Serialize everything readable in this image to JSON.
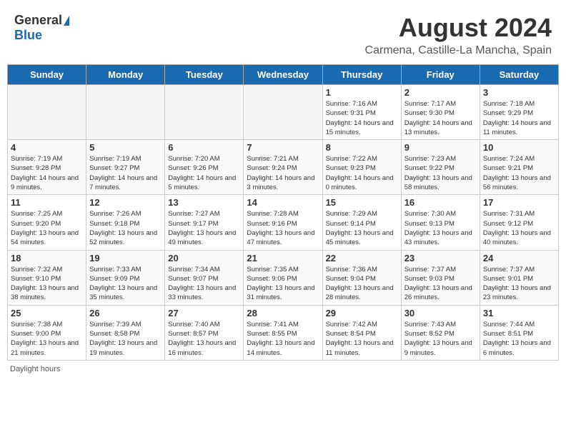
{
  "header": {
    "logo_general": "General",
    "logo_blue": "Blue",
    "month_year": "August 2024",
    "location": "Carmena, Castille-La Mancha, Spain"
  },
  "days_of_week": [
    "Sunday",
    "Monday",
    "Tuesday",
    "Wednesday",
    "Thursday",
    "Friday",
    "Saturday"
  ],
  "weeks": [
    [
      {
        "day": "",
        "info": ""
      },
      {
        "day": "",
        "info": ""
      },
      {
        "day": "",
        "info": ""
      },
      {
        "day": "",
        "info": ""
      },
      {
        "day": "1",
        "info": "Sunrise: 7:16 AM\nSunset: 9:31 PM\nDaylight: 14 hours and 15 minutes."
      },
      {
        "day": "2",
        "info": "Sunrise: 7:17 AM\nSunset: 9:30 PM\nDaylight: 14 hours and 13 minutes."
      },
      {
        "day": "3",
        "info": "Sunrise: 7:18 AM\nSunset: 9:29 PM\nDaylight: 14 hours and 11 minutes."
      }
    ],
    [
      {
        "day": "4",
        "info": "Sunrise: 7:19 AM\nSunset: 9:28 PM\nDaylight: 14 hours and 9 minutes."
      },
      {
        "day": "5",
        "info": "Sunrise: 7:19 AM\nSunset: 9:27 PM\nDaylight: 14 hours and 7 minutes."
      },
      {
        "day": "6",
        "info": "Sunrise: 7:20 AM\nSunset: 9:26 PM\nDaylight: 14 hours and 5 minutes."
      },
      {
        "day": "7",
        "info": "Sunrise: 7:21 AM\nSunset: 9:24 PM\nDaylight: 14 hours and 3 minutes."
      },
      {
        "day": "8",
        "info": "Sunrise: 7:22 AM\nSunset: 9:23 PM\nDaylight: 14 hours and 0 minutes."
      },
      {
        "day": "9",
        "info": "Sunrise: 7:23 AM\nSunset: 9:22 PM\nDaylight: 13 hours and 58 minutes."
      },
      {
        "day": "10",
        "info": "Sunrise: 7:24 AM\nSunset: 9:21 PM\nDaylight: 13 hours and 56 minutes."
      }
    ],
    [
      {
        "day": "11",
        "info": "Sunrise: 7:25 AM\nSunset: 9:20 PM\nDaylight: 13 hours and 54 minutes."
      },
      {
        "day": "12",
        "info": "Sunrise: 7:26 AM\nSunset: 9:18 PM\nDaylight: 13 hours and 52 minutes."
      },
      {
        "day": "13",
        "info": "Sunrise: 7:27 AM\nSunset: 9:17 PM\nDaylight: 13 hours and 49 minutes."
      },
      {
        "day": "14",
        "info": "Sunrise: 7:28 AM\nSunset: 9:16 PM\nDaylight: 13 hours and 47 minutes."
      },
      {
        "day": "15",
        "info": "Sunrise: 7:29 AM\nSunset: 9:14 PM\nDaylight: 13 hours and 45 minutes."
      },
      {
        "day": "16",
        "info": "Sunrise: 7:30 AM\nSunset: 9:13 PM\nDaylight: 13 hours and 43 minutes."
      },
      {
        "day": "17",
        "info": "Sunrise: 7:31 AM\nSunset: 9:12 PM\nDaylight: 13 hours and 40 minutes."
      }
    ],
    [
      {
        "day": "18",
        "info": "Sunrise: 7:32 AM\nSunset: 9:10 PM\nDaylight: 13 hours and 38 minutes."
      },
      {
        "day": "19",
        "info": "Sunrise: 7:33 AM\nSunset: 9:09 PM\nDaylight: 13 hours and 35 minutes."
      },
      {
        "day": "20",
        "info": "Sunrise: 7:34 AM\nSunset: 9:07 PM\nDaylight: 13 hours and 33 minutes."
      },
      {
        "day": "21",
        "info": "Sunrise: 7:35 AM\nSunset: 9:06 PM\nDaylight: 13 hours and 31 minutes."
      },
      {
        "day": "22",
        "info": "Sunrise: 7:36 AM\nSunset: 9:04 PM\nDaylight: 13 hours and 28 minutes."
      },
      {
        "day": "23",
        "info": "Sunrise: 7:37 AM\nSunset: 9:03 PM\nDaylight: 13 hours and 26 minutes."
      },
      {
        "day": "24",
        "info": "Sunrise: 7:37 AM\nSunset: 9:01 PM\nDaylight: 13 hours and 23 minutes."
      }
    ],
    [
      {
        "day": "25",
        "info": "Sunrise: 7:38 AM\nSunset: 9:00 PM\nDaylight: 13 hours and 21 minutes."
      },
      {
        "day": "26",
        "info": "Sunrise: 7:39 AM\nSunset: 8:58 PM\nDaylight: 13 hours and 19 minutes."
      },
      {
        "day": "27",
        "info": "Sunrise: 7:40 AM\nSunset: 8:57 PM\nDaylight: 13 hours and 16 minutes."
      },
      {
        "day": "28",
        "info": "Sunrise: 7:41 AM\nSunset: 8:55 PM\nDaylight: 13 hours and 14 minutes."
      },
      {
        "day": "29",
        "info": "Sunrise: 7:42 AM\nSunset: 8:54 PM\nDaylight: 13 hours and 11 minutes."
      },
      {
        "day": "30",
        "info": "Sunrise: 7:43 AM\nSunset: 8:52 PM\nDaylight: 13 hours and 9 minutes."
      },
      {
        "day": "31",
        "info": "Sunrise: 7:44 AM\nSunset: 8:51 PM\nDaylight: 13 hours and 6 minutes."
      }
    ]
  ],
  "footer": {
    "note": "Daylight hours"
  }
}
